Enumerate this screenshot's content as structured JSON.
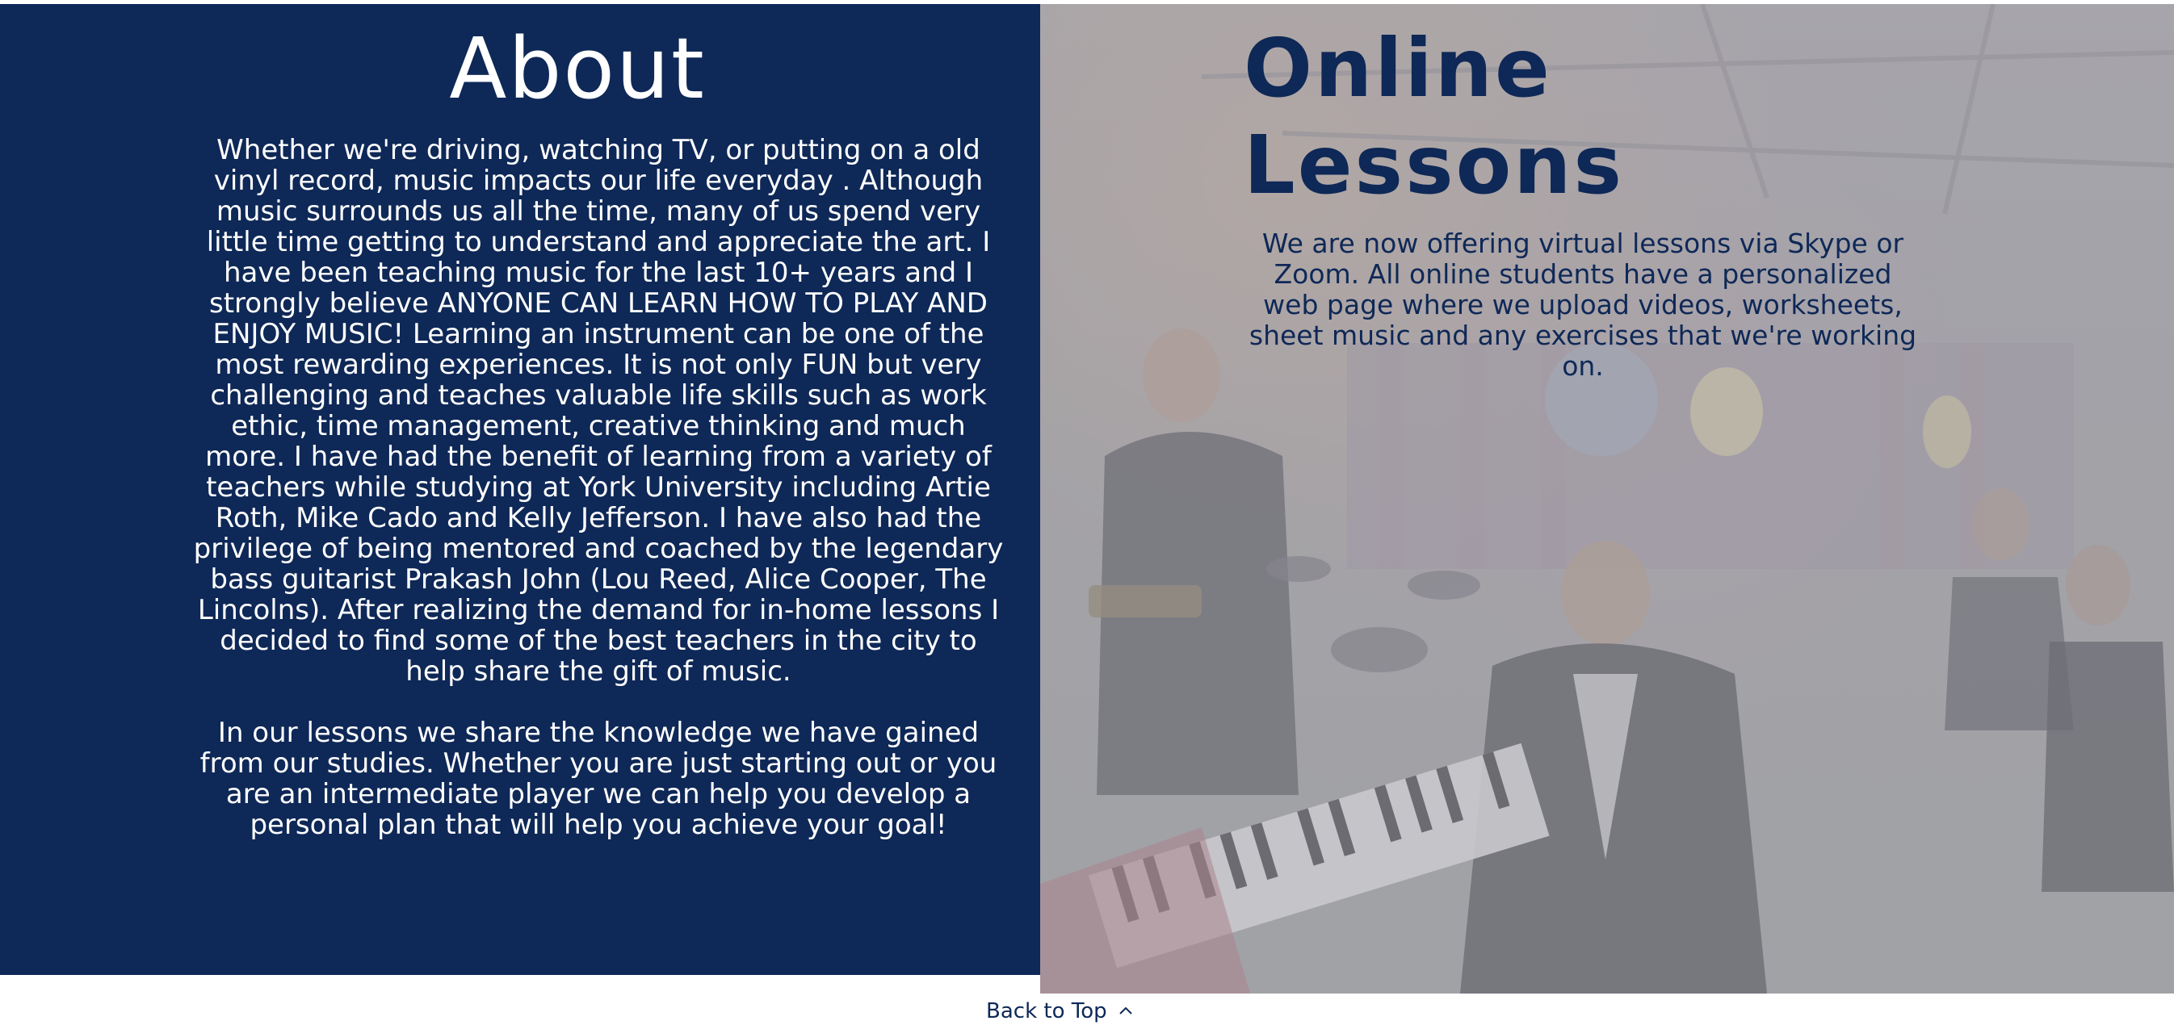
{
  "about": {
    "title": "About",
    "paragraphs": [
      "Whether we're driving, watching TV, or putting on a old vinyl record, music impacts our life everyday .  Although music surrounds us all the time, many of us spend very little time getting to understand and appreciate the art. I have been teaching music for the last 10+ years and I strongly believe ANYONE CAN LEARN HOW TO PLAY AND ENJOY MUSIC! Learning an instrument can be one of the most rewarding experiences. It is not only FUN but very challenging and teaches valuable life skills such as work ethic, time management, creative thinking and much more. I have had the benefit of learning from a variety of teachers while studying at York University including Artie Roth, Mike Cado and Kelly Jefferson.  I have also had the privilege of being mentored and coached by the legendary bass guitarist Prakash John (Lou Reed, Alice Cooper, The Lincolns). After realizing the demand for in-home lessons I decided to find some of the best teachers in the city to help share the gift of music.",
      "In our lessons we share the knowledge we have gained from our studies.  Whether you are just starting out or you are an intermediate player we can help you develop a personal plan that will help you achieve your goal!"
    ]
  },
  "online": {
    "title_line1": "Online",
    "title_line2": "Lessons",
    "body": "We are now offering virtual lessons via Skype or Zoom. All online students have a personalized web page where we upload videos, worksheets, sheet music and any exercises that we're working on."
  },
  "footer": {
    "back_to_top": "Back to Top",
    "icon": "chevron-up-icon"
  },
  "colors": {
    "navy": "#0e2857",
    "photo_overlay": "#a3a3a8",
    "white": "#ffffff"
  }
}
